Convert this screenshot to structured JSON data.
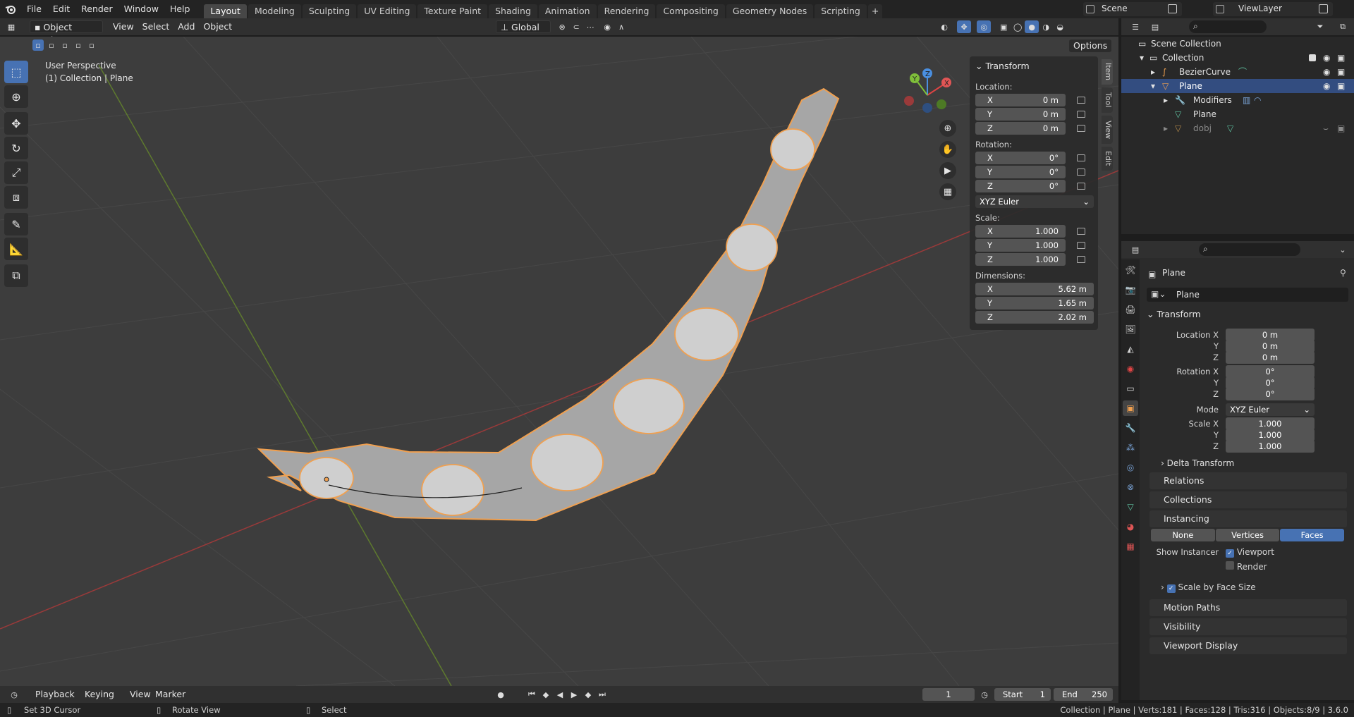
{
  "menu": {
    "items": [
      "File",
      "Edit",
      "Render",
      "Window",
      "Help"
    ]
  },
  "workspaces": {
    "tabs": [
      "Layout",
      "Modeling",
      "Sculpting",
      "UV Editing",
      "Texture Paint",
      "Shading",
      "Animation",
      "Rendering",
      "Compositing",
      "Geometry Nodes",
      "Scripting"
    ],
    "active": "Layout",
    "add": "+"
  },
  "scene": {
    "name": "Scene",
    "view_layer": "ViewLayer"
  },
  "viewport_header": {
    "mode": "Object Mode",
    "view": "View",
    "select": "Select",
    "add": "Add",
    "object": "Object",
    "orientation": "Global",
    "options": "Options"
  },
  "overlay_text": {
    "perspective": "User Perspective",
    "collection": "(1) Collection | Plane"
  },
  "gizmo": {
    "x": "X",
    "y": "Y",
    "z": "Z"
  },
  "npanel": {
    "title": "Transform",
    "location_label": "Location:",
    "rotation_label": "Rotation:",
    "scale_label": "Scale:",
    "dimensions_label": "Dimensions:",
    "location": [
      {
        "ax": "X",
        "val": "0 m"
      },
      {
        "ax": "Y",
        "val": "0 m"
      },
      {
        "ax": "Z",
        "val": "0 m"
      }
    ],
    "rotation": [
      {
        "ax": "X",
        "val": "0°"
      },
      {
        "ax": "Y",
        "val": "0°"
      },
      {
        "ax": "Z",
        "val": "0°"
      }
    ],
    "rotation_mode": "XYZ Euler",
    "scale": [
      {
        "ax": "X",
        "val": "1.000"
      },
      {
        "ax": "Y",
        "val": "1.000"
      },
      {
        "ax": "Z",
        "val": "1.000"
      }
    ],
    "dimensions": [
      {
        "ax": "X",
        "val": "5.62 m"
      },
      {
        "ax": "Y",
        "val": "1.65 m"
      },
      {
        "ax": "Z",
        "val": "2.02 m"
      }
    ],
    "tabs": [
      "Item",
      "Tool",
      "View",
      "Edit"
    ]
  },
  "outliner": {
    "rows": [
      {
        "label": "Scene Collection"
      },
      {
        "label": "Collection"
      },
      {
        "label": "BezierCurve"
      },
      {
        "label": "Plane"
      },
      {
        "label": "Modifiers"
      },
      {
        "label": "Plane"
      },
      {
        "label": "dobj"
      }
    ]
  },
  "properties": {
    "object_name": "Plane",
    "datablock": "Plane",
    "transform_title": "Transform",
    "location_label": "Location X",
    "rotation_label": "Rotation X",
    "scale_label": "Scale X",
    "mode_label": "Mode",
    "y": "Y",
    "z": "Z",
    "location": [
      "0 m",
      "0 m",
      "0 m"
    ],
    "rotation": [
      "0°",
      "0°",
      "0°"
    ],
    "mode": "XYZ Euler",
    "scale": [
      "1.000",
      "1.000",
      "1.000"
    ],
    "delta": "Delta Transform",
    "relations": "Relations",
    "collections": "Collections",
    "instancing": "Instancing",
    "instancing_options": [
      "None",
      "Vertices",
      "Faces"
    ],
    "instancing_active": "Faces",
    "show_instancer": "Show Instancer",
    "viewport": "Viewport",
    "render": "Render",
    "scale_face": "Scale by Face Size",
    "motion": "Motion Paths",
    "visibility": "Visibility",
    "viewport_display": "Viewport Display"
  },
  "timeline": {
    "playback": "Playback",
    "keying": "Keying",
    "view": "View",
    "marker": "Marker",
    "frame": "1",
    "start_label": "Start",
    "start": "1",
    "end_label": "End",
    "end": "250"
  },
  "status": {
    "left1": "Set 3D Cursor",
    "left2": "Rotate View",
    "left3": "Select",
    "right": "Collection | Plane | Verts:181 | Faces:128 | Tris:316 | Objects:8/9 | 3.6.0"
  },
  "colors": {
    "accent": "#4772b3",
    "selection": "#f0a050",
    "viewport_bg": "#3d3d3d"
  }
}
